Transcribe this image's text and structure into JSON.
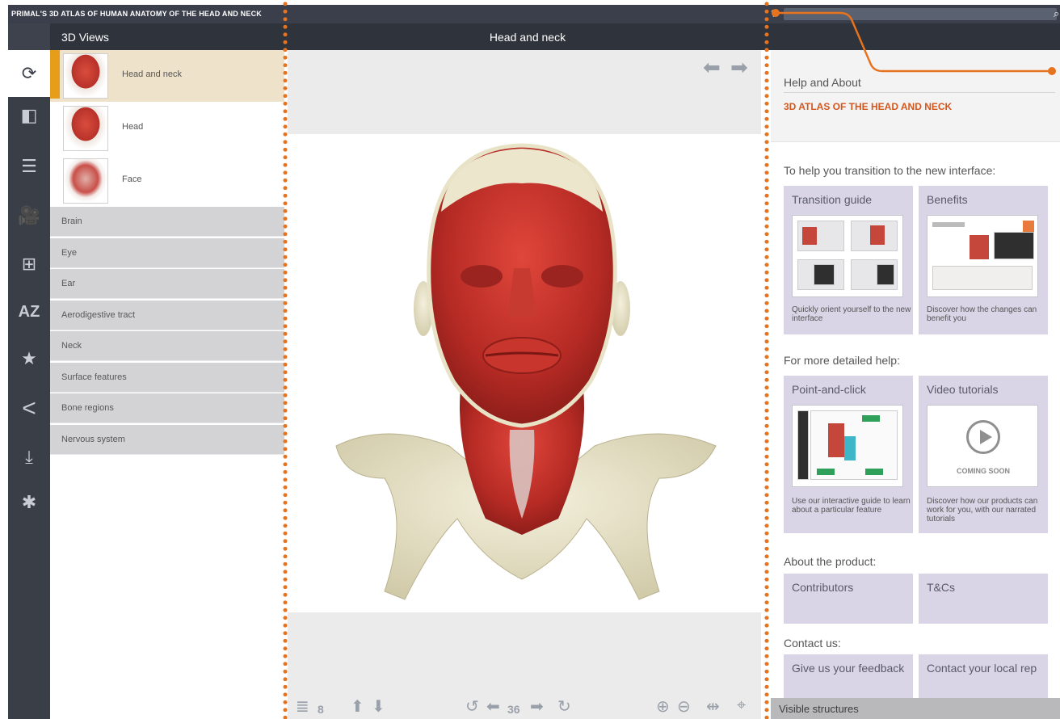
{
  "app": {
    "title": "PRIMAL'S 3D ATLAS OF HUMAN ANATOMY OF THE HEAD AND NECK",
    "help_glyph": "?",
    "search_glyph": "⌕"
  },
  "header": {
    "left_title": "3D Views",
    "center_title": "Head and neck"
  },
  "rail": {
    "items": [
      {
        "name": "3d-views-icon",
        "glyph": "⟳"
      },
      {
        "name": "slides-icon",
        "glyph": "◧"
      },
      {
        "name": "documents-icon",
        "glyph": "☰"
      },
      {
        "name": "movies-icon",
        "glyph": "🎥"
      },
      {
        "name": "hierarchy-icon",
        "glyph": "⊞"
      },
      {
        "name": "a-to-z-icon",
        "glyph": "AZ"
      },
      {
        "name": "favorites-icon",
        "glyph": "★"
      },
      {
        "name": "share-icon",
        "glyph": "<"
      },
      {
        "name": "download-icon",
        "glyph": "⤓"
      },
      {
        "name": "settings-icon",
        "glyph": "✱"
      }
    ]
  },
  "views": {
    "thumbs": [
      "Head and neck",
      "Head",
      "Face"
    ],
    "categories": [
      "Brain",
      "Eye",
      "Ear",
      "Aerodigestive tract",
      "Neck",
      "Surface features",
      "Bone regions",
      "Nervous system"
    ]
  },
  "viewer": {
    "layers_count": "8",
    "rotation_step": "36",
    "left_arrow": "⬅",
    "right_arrow": "➡",
    "up_arrow": "⬆",
    "down_arrow": "⬇",
    "zoom_in": "⊕",
    "zoom_out": "⊖",
    "layers_glyph": "≣",
    "rotate_left": "↺",
    "rotate_right": "↻",
    "flip_glyph": "⇹",
    "reset_glyph": "⌖"
  },
  "help": {
    "heading": "Help and About",
    "subheading": "3D ATLAS OF THE HEAD AND NECK",
    "section_transition": "To help you transition to the new interface:",
    "card_transition_title": "Transition guide",
    "card_transition_desc": "Quickly orient yourself to the new interface",
    "card_benefits_title": "Benefits",
    "card_benefits_desc": "Discover how the changes can benefit you",
    "section_detailed": "For more detailed help:",
    "card_point_title": "Point-and-click",
    "card_point_desc": "Use our interactive guide to learn about a particular feature",
    "card_video_title": "Video tutorials",
    "card_video_desc": "Discover how our products can work for you, with our narrated tutorials",
    "coming_soon": "COMING SOON",
    "section_about": "About the product:",
    "card_contributors": "Contributors",
    "card_tcs": "T&Cs",
    "section_contact": "Contact us:",
    "card_feedback": "Give us your feedback",
    "card_local_rep": "Contact your local rep",
    "visible_structures": "Visible structures"
  },
  "colors": {
    "accent_orange": "#e7731e",
    "selection_bar": "#e69d1a",
    "card_lilac": "#d9d4e6",
    "dark_chrome": "#2f333b"
  }
}
